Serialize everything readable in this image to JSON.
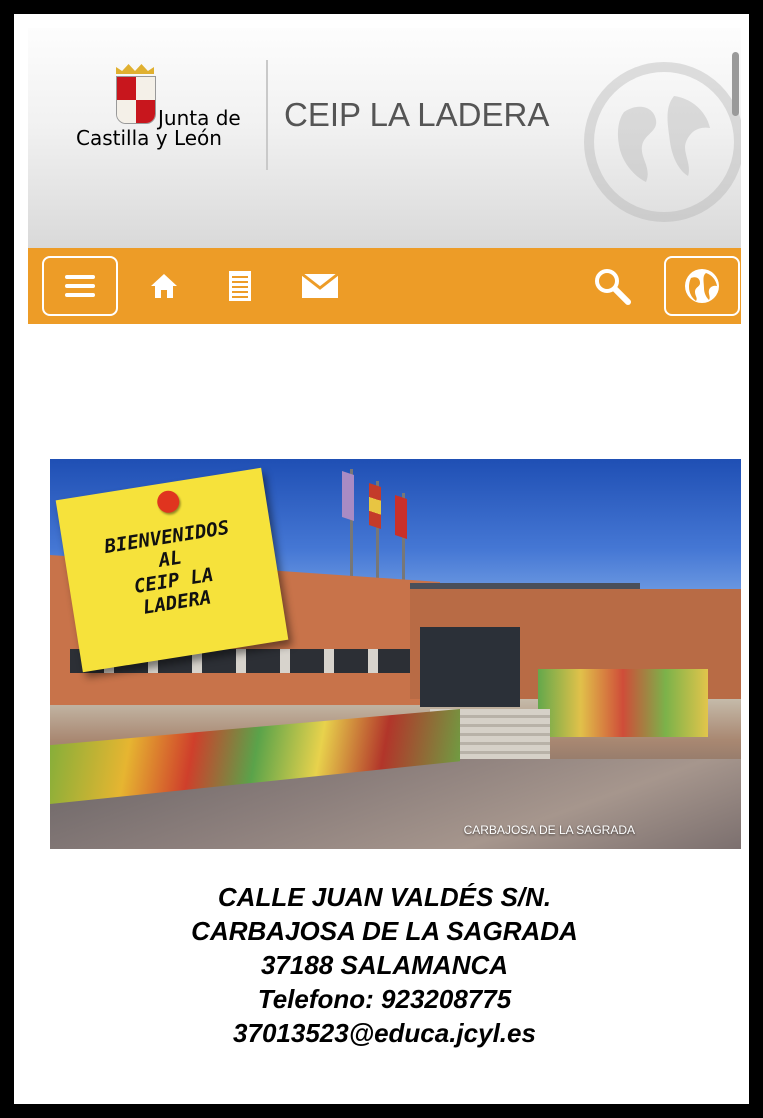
{
  "header": {
    "logo_line1": "Junta de",
    "logo_line2": "Castilla y León",
    "site_title": "CEIP LA LADERA"
  },
  "navbar": {
    "color": "#ed9c27",
    "items": [
      {
        "icon": "menu-icon"
      },
      {
        "icon": "home-icon"
      },
      {
        "icon": "document-icon"
      },
      {
        "icon": "mail-icon"
      },
      {
        "icon": "search-icon"
      },
      {
        "icon": "globe-icon"
      }
    ]
  },
  "banner": {
    "sticky_lines": [
      "BIENVENIDOS",
      "AL",
      "CEIP LA",
      "LADERA"
    ],
    "caption": "CARBAJOSA DE LA SAGRADA"
  },
  "address": {
    "line1": "CALLE JUAN VALDÉS S/N.",
    "line2": "CARBAJOSA DE LA SAGRADA",
    "line3": "37188 SALAMANCA",
    "line4": "Telefono: 923208775",
    "line5": "37013523@educa.jcyl.es"
  }
}
